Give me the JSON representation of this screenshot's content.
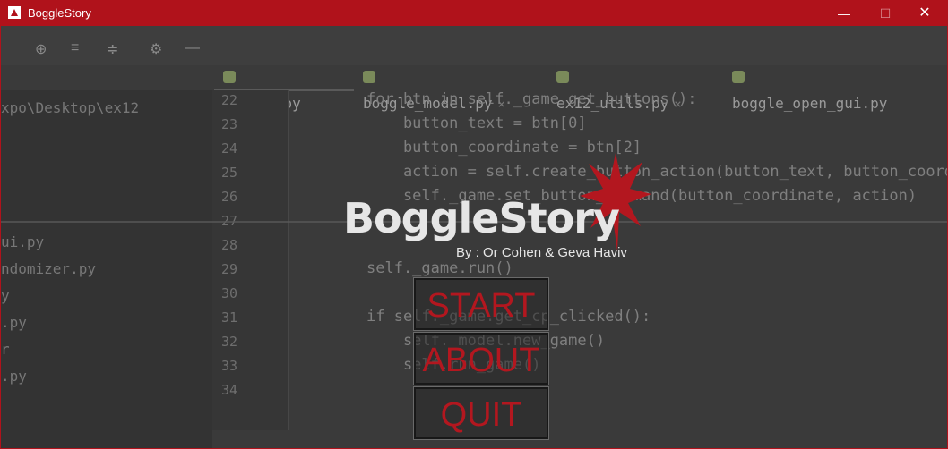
{
  "window": {
    "title": "BoggleStory",
    "controls": {
      "minimize": "—",
      "maximize": "☐",
      "close": "✕"
    }
  },
  "ide": {
    "tabs": [
      {
        "label": "boggle.py"
      },
      {
        "label": "boggle_model.py"
      },
      {
        "label": "ex12_utils.py"
      },
      {
        "label": "boggle_open_gui.py"
      }
    ],
    "project_path": "xpo\\Desktop\\ex12",
    "project_files": [
      "ui.py",
      "ndomizer.py",
      "y",
      ".py",
      "r",
      ".py"
    ],
    "line_numbers": [
      "22",
      "23",
      "24",
      "25",
      "26",
      "27",
      "28",
      "29",
      "30",
      "31",
      "32",
      "33",
      "34"
    ],
    "code_lines": [
      "for btn in self._game.get_buttons():",
      "    button_text = btn[0]",
      "    button_coordinate = btn[2]",
      "    action = self.create_button_action(button_text, button_coordi",
      "    self._game.set_button_command(button_coordinate, action)",
      "",
      "",
      "self._game.run()",
      "",
      "if self._game.get_cp_clicked():",
      "    self._model.new_game()",
      "    self.run_game()",
      ""
    ]
  },
  "splash": {
    "logo": "BoggleStory",
    "byline": "By : Or Cohen & Geva Haviv",
    "accent_color": "#b3171f",
    "buttons": {
      "start": "START",
      "about": "ABOUT",
      "quit": "QUIT"
    }
  }
}
